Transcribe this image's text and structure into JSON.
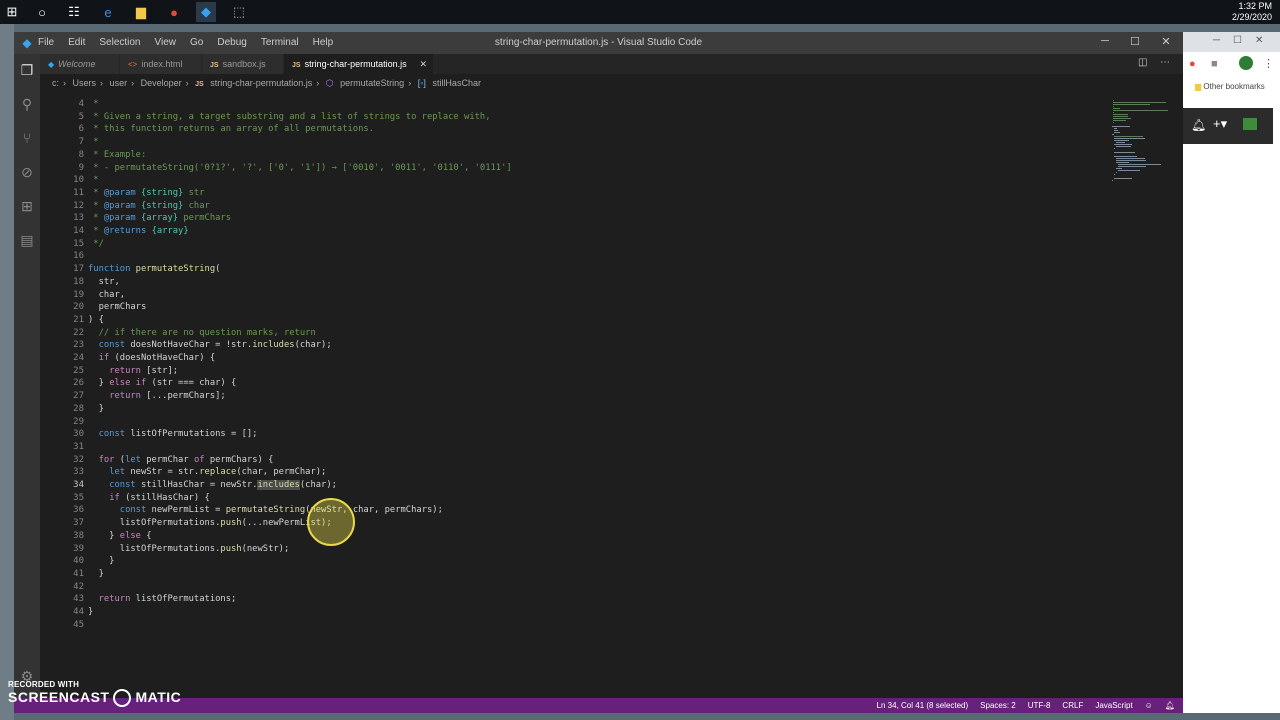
{
  "taskbar": {
    "clock_time": "1:32 PM",
    "clock_date": "2/29/2020"
  },
  "window": {
    "title": "string-char-permutation.js - Visual Studio Code",
    "menu": [
      "File",
      "Edit",
      "Selection",
      "View",
      "Go",
      "Debug",
      "Terminal",
      "Help"
    ]
  },
  "tabs": [
    {
      "label": "Welcome",
      "icon": "vscode-icon"
    },
    {
      "label": "index.html",
      "icon": "html-icon"
    },
    {
      "label": "sandbox.js",
      "icon": "js-icon"
    },
    {
      "label": "string-char-permutation.js",
      "icon": "js-icon",
      "active": true
    }
  ],
  "breadcrumb": [
    "c:",
    "Users",
    "user",
    "Developer",
    "string-char-permutation.js",
    "permutateString",
    "stillHasChar"
  ],
  "code_lines": [
    {
      "n": "4",
      "t": " *"
    },
    {
      "n": "5",
      "t": " * Given a string, a target substring and a list of strings to replace with,"
    },
    {
      "n": "6",
      "t": " * this function returns an array of all permutations."
    },
    {
      "n": "7",
      "t": " *"
    },
    {
      "n": "8",
      "t": " * Example:"
    },
    {
      "n": "9",
      "t": " * - permutateString('0?1?', '?', ['0', '1']) → ['0010', '0011', '0110', '0111']"
    },
    {
      "n": "10",
      "t": " *"
    },
    {
      "n": "11",
      "t": " * @param {string} str"
    },
    {
      "n": "12",
      "t": " * @param {string} char"
    },
    {
      "n": "13",
      "t": " * @param {array} permChars"
    },
    {
      "n": "14",
      "t": " * @returns {array}"
    },
    {
      "n": "15",
      "t": " */"
    },
    {
      "n": "16",
      "t": ""
    },
    {
      "n": "17",
      "t": "function permutateString("
    },
    {
      "n": "18",
      "t": "  str,"
    },
    {
      "n": "19",
      "t": "  char,"
    },
    {
      "n": "20",
      "t": "  permChars"
    },
    {
      "n": "21",
      "t": ") {"
    },
    {
      "n": "22",
      "t": "  // if there are no question marks, return"
    },
    {
      "n": "23",
      "t": "  const doesNotHaveChar = !str.includes(char);"
    },
    {
      "n": "24",
      "t": "  if (doesNotHaveChar) {"
    },
    {
      "n": "25",
      "t": "    return [str];"
    },
    {
      "n": "26",
      "t": "  } else if (str === char) {"
    },
    {
      "n": "27",
      "t": "    return [...permChars];"
    },
    {
      "n": "28",
      "t": "  }"
    },
    {
      "n": "29",
      "t": ""
    },
    {
      "n": "30",
      "t": "  const listOfPermutations = [];"
    },
    {
      "n": "31",
      "t": ""
    },
    {
      "n": "32",
      "t": "  for (let permChar of permChars) {"
    },
    {
      "n": "33",
      "t": "    let newStr = str.replace(char, permChar);"
    },
    {
      "n": "34",
      "t": "    const stillHasChar = newStr.includes(char);"
    },
    {
      "n": "35",
      "t": "    if (stillHasChar) {"
    },
    {
      "n": "36",
      "t": "      const newPermList = permutateString(newStr, char, permChars);"
    },
    {
      "n": "37",
      "t": "      listOfPermutations.push(...newPermList);"
    },
    {
      "n": "38",
      "t": "    } else {"
    },
    {
      "n": "39",
      "t": "      listOfPermutations.push(newStr);"
    },
    {
      "n": "40",
      "t": "    }"
    },
    {
      "n": "41",
      "t": "  }"
    },
    {
      "n": "42",
      "t": ""
    },
    {
      "n": "43",
      "t": "  return listOfPermutations;"
    },
    {
      "n": "44",
      "t": "}"
    },
    {
      "n": "45",
      "t": ""
    }
  ],
  "statusbar": {
    "position": "Ln 34, Col 41 (8 selected)",
    "spaces": "Spaces: 2",
    "encoding": "UTF-8",
    "eol": "CRLF",
    "language": "JavaScript"
  },
  "chrome": {
    "bookmarks_label": "Other bookmarks"
  },
  "watermark": {
    "recorded": "RECORDED WITH",
    "brand_left": "SCREENCAST",
    "brand_right": "MATIC"
  },
  "colors": {
    "statusbar": "#68217a",
    "editor_bg": "#1e1e1e",
    "comment": "#6a9955",
    "keyword": "#569cd6"
  }
}
